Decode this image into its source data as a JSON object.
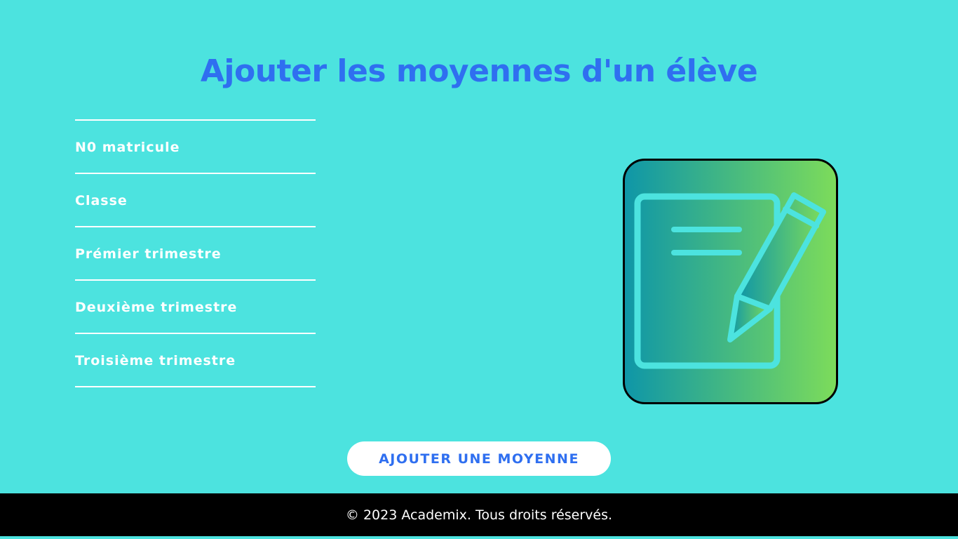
{
  "page": {
    "title": "Ajouter les moyennes d'un élève"
  },
  "form": {
    "fields": [
      {
        "label": "N0 matricule"
      },
      {
        "label": "Classe"
      },
      {
        "label": "Prémier trimestre"
      },
      {
        "label": "Deuxième trimestre"
      },
      {
        "label": "Troisième trimestre"
      }
    ]
  },
  "actions": {
    "submit_label": "AJOUTER UNE MOYENNE"
  },
  "illustration": {
    "icon": "notepad-pencil-icon"
  },
  "footer": {
    "text": "© 2023 Academix. Tous droits réservés."
  },
  "colors": {
    "background": "#4ce3df",
    "accent": "#2f6ff0",
    "footer": "#000000",
    "gradient_start": "#0e96a8",
    "gradient_end": "#7ddc5a"
  }
}
